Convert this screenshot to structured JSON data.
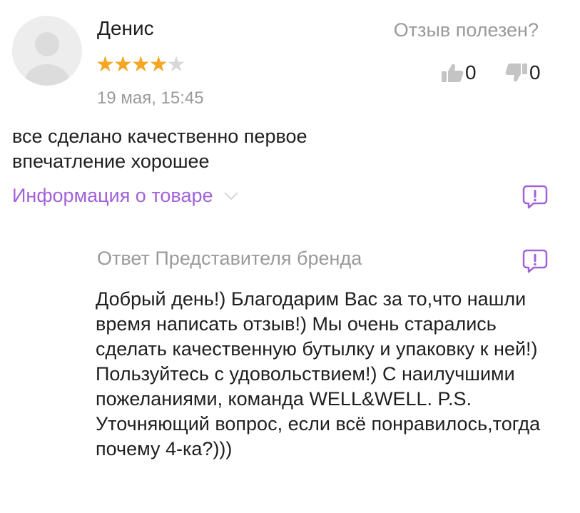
{
  "review": {
    "author": "Денис",
    "rating": 4,
    "max_rating": 5,
    "date": "19 мая, 15:45",
    "text": "все сделано качественно первое впечатление хорошее",
    "product_info_link": "Информация о товаре"
  },
  "helpful": {
    "title": "Отзыв полезен?",
    "likes": "0",
    "dislikes": "0"
  },
  "brand_reply": {
    "title": "Ответ Представителя бренда",
    "text": "Добрый день!) Благодарим Вас за то,что нашли время написать отзыв!) Мы очень старались сделать качественную бутылку и упаковку к ней!) Пользуйтесь с удовольствием!) С наилучшими пожеланиями, команда WELL&WELL.  P.S. Уточняющий вопрос, если всё понравилось,тогда почему 4-ка?)))"
  },
  "icons": {
    "avatar": "avatar-placeholder-icon",
    "like": "thumbs-up-icon",
    "dislike": "thumbs-down-icon",
    "chevron": "chevron-down-icon",
    "report": "report-exclamation-icon"
  },
  "colors": {
    "accent": "#a162d8",
    "star_filled": "#f5a623",
    "star_empty": "#d8d8d8",
    "muted_text": "#9a9a9a",
    "icon_gray": "#c4c4c4"
  }
}
